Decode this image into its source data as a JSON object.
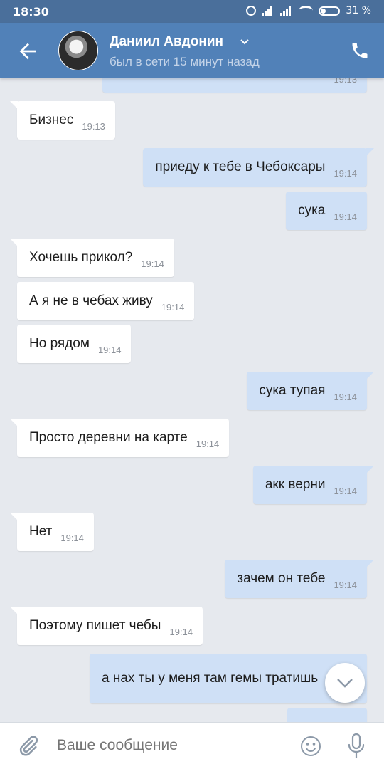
{
  "status_bar": {
    "time": "18:30",
    "battery": "31 %",
    "battery_level": 0.31
  },
  "header": {
    "contact_name": "Даниил Авдонин",
    "status": "был в сети 15 минут назад"
  },
  "messages": [
    {
      "dir": "out",
      "text": "",
      "time": "19:13"
    },
    {
      "dir": "in",
      "text": "Бизнес",
      "time": "19:13"
    },
    {
      "dir": "out",
      "text": "приеду к тебе в Чебоксары",
      "time": "19:14"
    },
    {
      "dir": "out",
      "text": "сука",
      "time": "19:14"
    },
    {
      "dir": "in",
      "text": "Хочешь прикол?",
      "time": "19:14"
    },
    {
      "dir": "in",
      "text": "А я не в чебах живу",
      "time": "19:14"
    },
    {
      "dir": "in",
      "text": "Но рядом",
      "time": "19:14"
    },
    {
      "dir": "out",
      "text": "сука тупая",
      "time": "19:14"
    },
    {
      "dir": "in",
      "text": "Просто деревни на карте",
      "time": "19:14"
    },
    {
      "dir": "out",
      "text": "акк верни",
      "time": "19:14"
    },
    {
      "dir": "in",
      "text": "Нет",
      "time": "19:14"
    },
    {
      "dir": "out",
      "text": "зачем он тебе",
      "time": "19:14"
    },
    {
      "dir": "in",
      "text": "Поэтому пишет чебы",
      "time": "19:14"
    },
    {
      "dir": "out",
      "text": "а нах ты у меня там гемы тратишь",
      "time": ""
    },
    {
      "dir": "out",
      "text": "",
      "time": ""
    }
  ],
  "composer": {
    "placeholder": "Ваше сообщение"
  },
  "icons": {
    "back": "arrow-left-icon",
    "phone": "phone-icon",
    "attach": "paperclip-icon",
    "emoji": "smiley-icon",
    "mic": "microphone-icon",
    "scroll": "chevron-down-icon"
  },
  "colors": {
    "header": "#5181b8",
    "status_bar": "#4a6f9b",
    "background": "#e6e9ee",
    "incoming_bubble": "#ffffff",
    "outgoing_bubble": "#cfe0f6"
  }
}
